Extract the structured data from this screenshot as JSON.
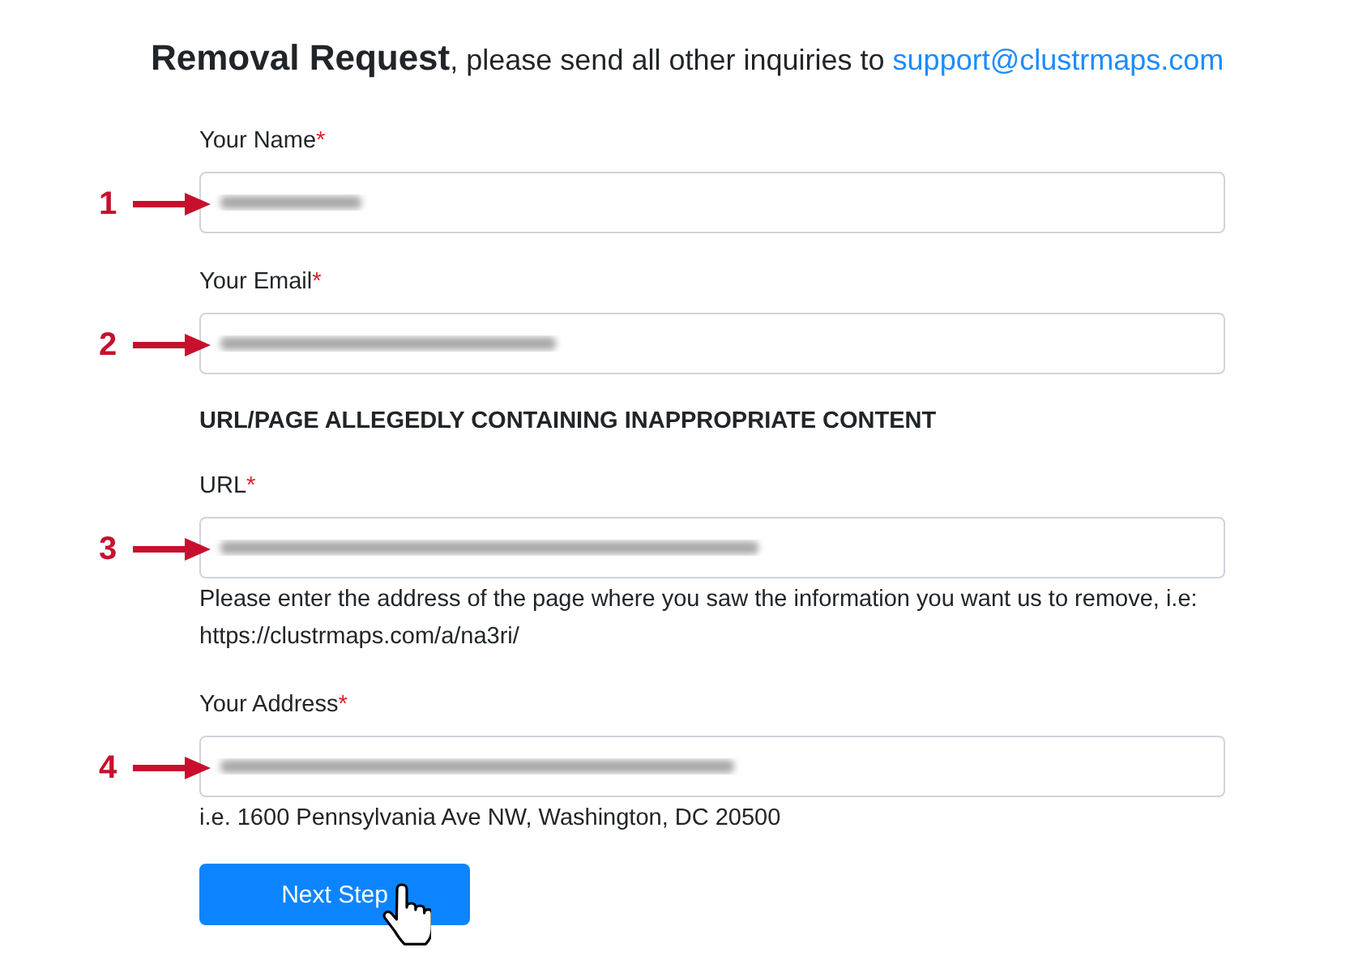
{
  "header": {
    "title": "Removal Request",
    "text": ", please send all other inquiries to",
    "link": "support@clustrmaps.com"
  },
  "form": [
    {
      "kind": "field",
      "label": "Your Name",
      "required": "*",
      "marker": "1",
      "blurred": true
    },
    {
      "kind": "field",
      "label": "Your Email",
      "required": "*",
      "marker": "2",
      "blurred": true
    },
    {
      "kind": "heading",
      "label": "URL/PAGE ALLEGEDLY CONTAINING INAPPROPRIATE CONTENT"
    },
    {
      "kind": "field",
      "label": "URL",
      "required": "*",
      "marker": "3",
      "blurred": true,
      "help": "Please enter the address of the page where you saw the information you want us to remove, i.e: https://clustrmaps.com/a/na3ri/"
    },
    {
      "kind": "field",
      "label": "Your Address",
      "required": "*",
      "marker": "4",
      "blurred": true,
      "help": "i.e. 1600 Pennsylvania Ave NW, Washington, DC 20500"
    }
  ],
  "button": {
    "label": "Next Step"
  }
}
